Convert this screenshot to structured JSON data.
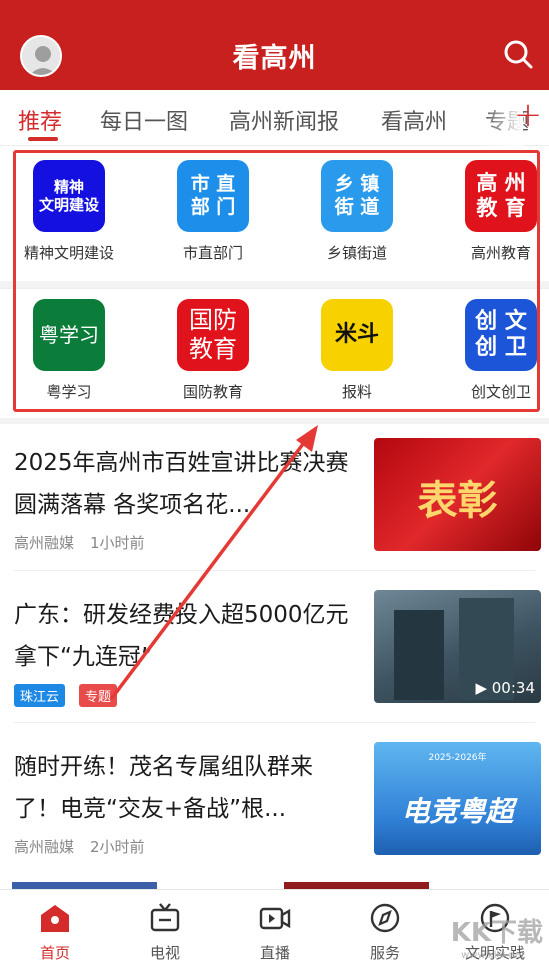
{
  "header": {
    "title": "看高州",
    "search_icon": "search-icon",
    "avatar_icon": "user-avatar"
  },
  "tabs": [
    {
      "label": "推荐",
      "active": true
    },
    {
      "label": "每日一图"
    },
    {
      "label": "高州新闻报"
    },
    {
      "label": "看高州"
    },
    {
      "label": "专题"
    }
  ],
  "add_tab_label": "+",
  "services": [
    {
      "label": "精神文明建设",
      "icon_text": "精神\n文明建设",
      "bg": "#1411e0"
    },
    {
      "label": "市直部门",
      "icon_text": "市直\n部门",
      "bg": "#1d8fea"
    },
    {
      "label": "乡镇街道",
      "icon_text": "乡镇\n街道",
      "bg": "#2a9bec"
    },
    {
      "label": "高州教育",
      "icon_text": "高州\n教育",
      "bg": "#e0121c"
    },
    {
      "label": "粤学习",
      "icon_text": "粤学习",
      "bg": "#0c7c3a"
    },
    {
      "label": "国防教育",
      "icon_text": "国防\n教育",
      "bg": "#e0121c"
    },
    {
      "label": "报料",
      "icon_text": "米斗",
      "bg": "#f7d100"
    },
    {
      "label": "创文创卫",
      "icon_text": "创文\n创卫",
      "bg": "#1c55d8"
    }
  ],
  "news": [
    {
      "title": "2025年高州市百姓宣讲比赛决赛圆满落幕 各奖项名花...",
      "source": "高州融媒",
      "time": "1小时前",
      "thumb_text": "表彰"
    },
    {
      "title": "广东：研发经费投入超5000亿元 拿下“九连冠”",
      "tag1": "珠江云",
      "tag2": "专题",
      "duration": "00:34"
    },
    {
      "title": "随时开练！茂名专属组队群来了！电竞“交友+备战”根...",
      "source": "高州融媒",
      "time": "2小时前",
      "thumb_text": "电竞粤超",
      "thumb_caption": "2025-2026年"
    }
  ],
  "bottom_nav": [
    {
      "label": "首页",
      "icon": "home-icon",
      "active": true
    },
    {
      "label": "电视",
      "icon": "tv-icon"
    },
    {
      "label": "直播",
      "icon": "live-video-icon"
    },
    {
      "label": "服务",
      "icon": "compass-icon"
    },
    {
      "label": "文明实践",
      "icon": "flag-icon"
    }
  ],
  "watermark": "KK下载",
  "watermark_url": "www.kkx.net",
  "colors": {
    "brand": "#c8201f",
    "accent": "#d42b2b"
  }
}
